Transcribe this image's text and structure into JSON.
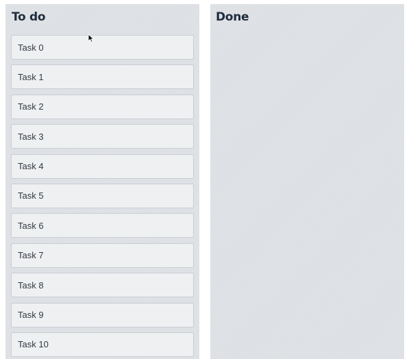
{
  "columns": {
    "todo": {
      "title": "To do",
      "tasks": [
        "Task 0",
        "Task 1",
        "Task 2",
        "Task 3",
        "Task 4",
        "Task 5",
        "Task 6",
        "Task 7",
        "Task 8",
        "Task 9",
        "Task 10"
      ]
    },
    "done": {
      "title": "Done",
      "tasks": []
    }
  },
  "colors": {
    "column_bg": "#dcdfe3",
    "card_bg": "#eef0f2",
    "title_text": "#1f2d3d"
  },
  "icons": {
    "cursor": "arrow-cursor-icon"
  }
}
